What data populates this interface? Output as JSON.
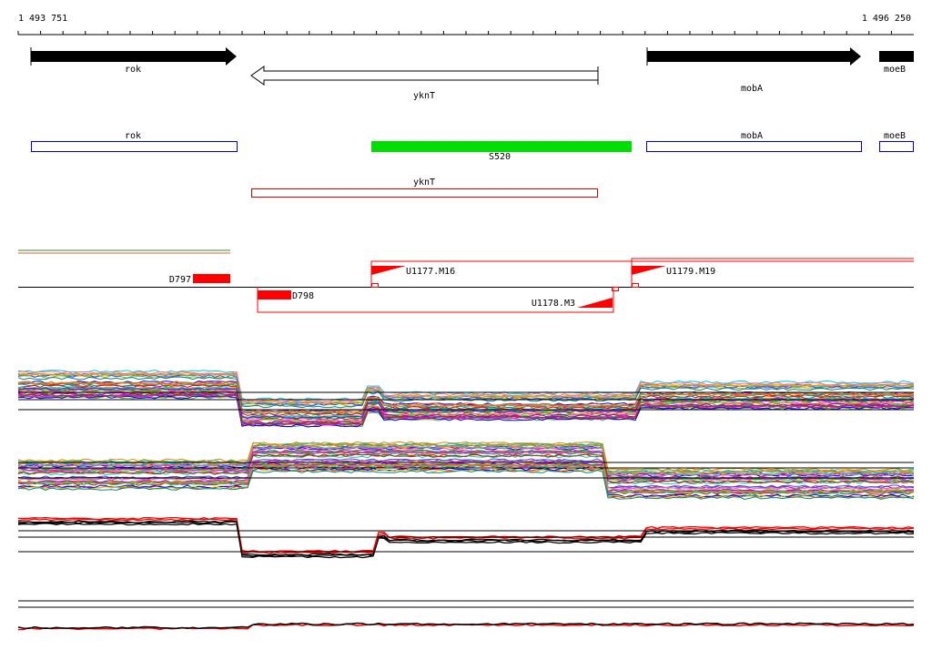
{
  "coordinates": {
    "start": "1 493 751",
    "end": "1 496 250"
  },
  "genes": [
    {
      "name": "rok",
      "strand": "+",
      "filled": true
    },
    {
      "name": "yknT",
      "strand": "-",
      "filled": false
    },
    {
      "name": "mobA",
      "strand": "+",
      "filled": true
    },
    {
      "name": "moeB",
      "strand": "+",
      "filled": true
    }
  ],
  "regions": [
    {
      "name": "rok",
      "color": "#0000cc"
    },
    {
      "name": "S520",
      "color": "#00dd00"
    },
    {
      "name": "mobA",
      "color": "#0000cc"
    },
    {
      "name": "moeB",
      "color": "#0000cc"
    },
    {
      "name": "yknT",
      "color": "#dd0000"
    }
  ],
  "segments": [
    {
      "name": "D797"
    },
    {
      "name": "D798"
    },
    {
      "name": "U1177.M16"
    },
    {
      "name": "U1178.M3"
    },
    {
      "name": "U1179.M19"
    }
  ],
  "colors": {
    "accent": "#ff0000",
    "region_green": "#00dd00",
    "region_blue": "#0000cc"
  }
}
